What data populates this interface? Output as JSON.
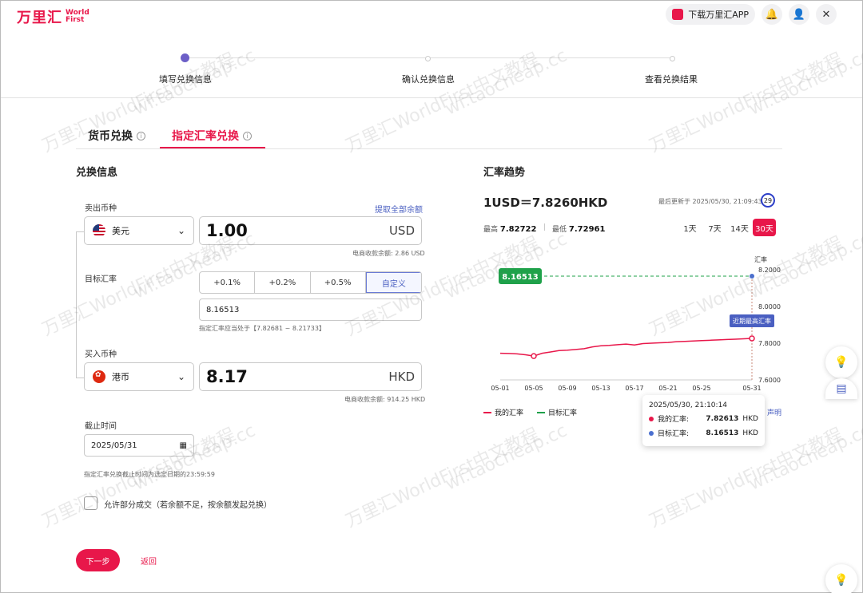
{
  "header": {
    "logo_cn": "万里汇",
    "logo_en": "World First",
    "download_app": "下载万里汇APP"
  },
  "steps": [
    "填写兑换信息",
    "确认兑换信息",
    "查看兑换结果"
  ],
  "tabs": {
    "currency_exchange": "货币兑换",
    "target_rate_exchange": "指定汇率兑换"
  },
  "form": {
    "section_title": "兑换信息",
    "sell_label": "卖出币种",
    "withdraw_all": "提取全部余额",
    "sell_currency": "美元",
    "sell_amount": "1.00",
    "sell_code": "USD",
    "sell_balance": "电商收款余额: 2.86 USD",
    "target_rate_label": "目标汇率",
    "rate_options": [
      "+0.1%",
      "+0.2%",
      "+0.5%",
      "自定义"
    ],
    "target_rate_value": "8.16513",
    "rate_hint": "指定汇率应当处于【7.82681 ~ 8.21733】",
    "buy_label": "买入币种",
    "buy_currency": "港币",
    "buy_amount": "8.17",
    "buy_code": "HKD",
    "buy_balance": "电商收款余额: 914.25 HKD",
    "deadline_label": "截止时间",
    "deadline_value": "2025/05/31",
    "deadline_hint": "指定汇率兑换截止时间为选定日期的23:59:59",
    "partial_label": "允许部分成交（若余额不足，按余额发起兑换）",
    "next": "下一步",
    "back": "返回"
  },
  "trend": {
    "title": "汇率趋势",
    "rate": "1USD＝7.8260HKD",
    "updated": "最后更新于 2025/05/30, 21:09:43",
    "countdown": "29",
    "high_label": "最高",
    "high_value": "7.82722",
    "low_label": "最低",
    "low_value": "7.72961",
    "ranges": [
      "1天",
      "7天",
      "14天",
      "30天"
    ],
    "legend_mine": "我的汇率",
    "legend_target": "目标汇率",
    "disclaimer": "声明",
    "tooltip": {
      "time": "2025/05/30, 21:10:14",
      "mine_label": "我的汇率:",
      "mine_value": "7.82613",
      "mine_unit": "HKD",
      "target_label": "目标汇率:",
      "target_value": "8.16513",
      "target_unit": "HKD"
    },
    "colors": {
      "mine": "#e8174a",
      "target": "#1fa14a",
      "target_dot": "#4a6fd0",
      "accent": "#e8174a"
    }
  },
  "chart_data": {
    "type": "line",
    "ylabel": "汇率",
    "ylim": [
      7.6,
      8.2
    ],
    "y_ticks": [
      "8.2000",
      "8.0000",
      "7.8000",
      "7.6000"
    ],
    "x_ticks": [
      "05-01",
      "05-05",
      "05-09",
      "05-13",
      "05-17",
      "05-21",
      "05-25",
      "05-31"
    ],
    "series": [
      {
        "name": "我的汇率",
        "x": [
          "05-01",
          "05-02",
          "05-03",
          "05-04",
          "05-05",
          "05-06",
          "05-07",
          "05-08",
          "05-09",
          "05-10",
          "05-11",
          "05-12",
          "05-13",
          "05-14",
          "05-15",
          "05-16",
          "05-17",
          "05-18",
          "05-19",
          "05-20",
          "05-21",
          "05-22",
          "05-23",
          "05-24",
          "05-25",
          "05-26",
          "05-27",
          "05-28",
          "05-29",
          "05-30",
          "05-31"
        ],
        "values": [
          7.745,
          7.744,
          7.742,
          7.737,
          7.73,
          7.745,
          7.752,
          7.76,
          7.762,
          7.766,
          7.77,
          7.78,
          7.786,
          7.788,
          7.792,
          7.795,
          7.79,
          7.798,
          7.8,
          7.802,
          7.804,
          7.808,
          7.81,
          7.812,
          7.814,
          7.816,
          7.818,
          7.82,
          7.822,
          7.824,
          7.826
        ]
      },
      {
        "name": "目标汇率",
        "value": 8.16513
      }
    ],
    "labels": {
      "target_tag": "8.16513",
      "recent_high": "近期最高汇率"
    }
  },
  "watermark": [
    "万里汇WorldFirst中文教程",
    "wf.taocheap.cc"
  ]
}
